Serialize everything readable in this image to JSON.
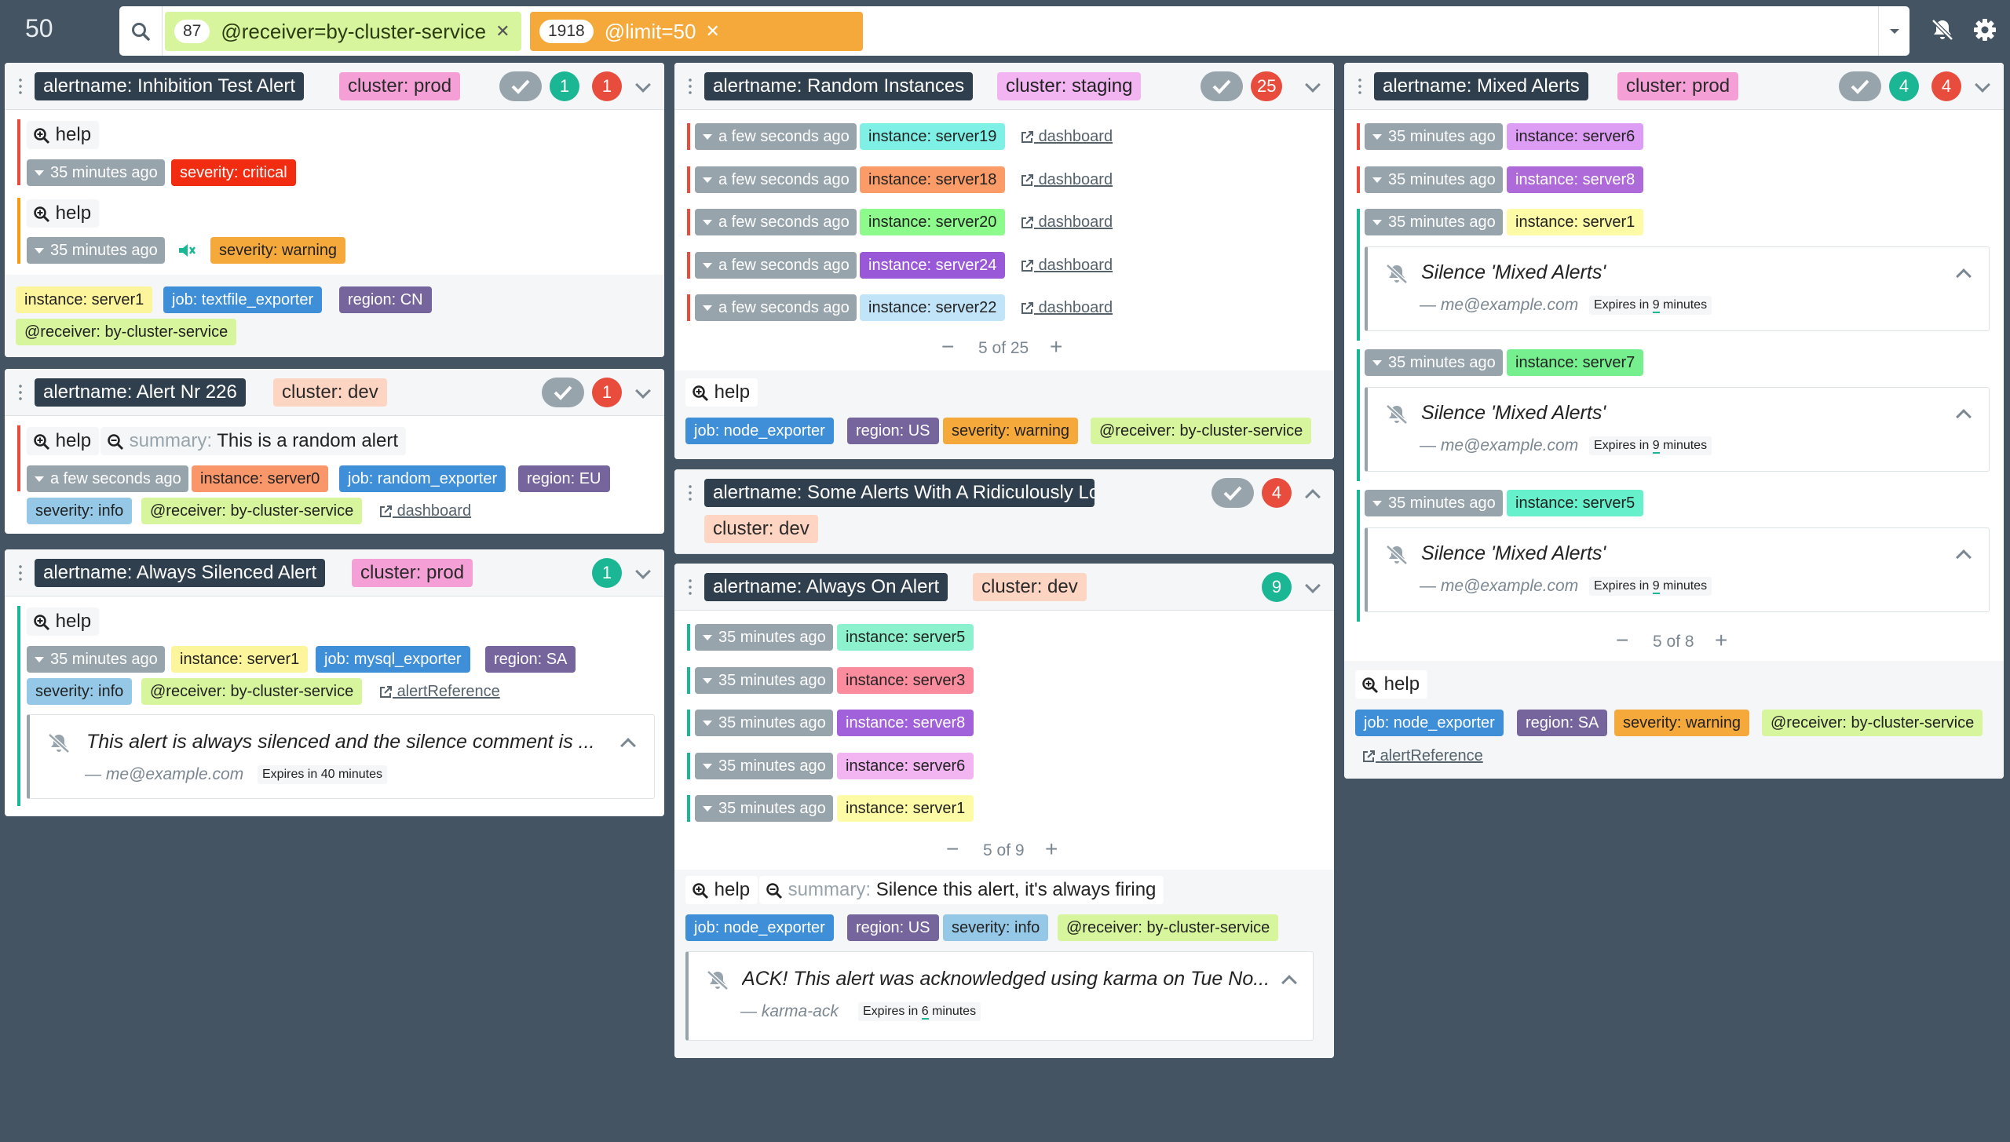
{
  "topbar": {
    "count": "50",
    "filters": [
      {
        "count": "87",
        "text": "@receiver=by-cluster-service"
      },
      {
        "count": "1918",
        "text": "@limit=50"
      }
    ]
  },
  "colors": {
    "background": "#455463",
    "green": "#1bb795",
    "red": "#e74c3c",
    "gray": "#98a4ac"
  },
  "col1": {
    "g1": {
      "alertname": "alertname: Inhibition Test Alert",
      "cluster": "cluster: prod",
      "green_count": "1",
      "red_count": "1",
      "help1": "help",
      "age1": "35 minutes ago",
      "sev1": "severity: critical",
      "help2": "help",
      "age2": "35 minutes ago",
      "sev2": "severity: warning",
      "labels": [
        "instance: server1",
        "job: textfile_exporter",
        "region: CN",
        "@receiver: by-cluster-service"
      ]
    },
    "g2": {
      "alertname": "alertname: Alert Nr 226",
      "cluster": "cluster: dev",
      "red_count": "1",
      "help": "help",
      "summary_key": "summary:",
      "summary_val": "This is a random alert",
      "age": "a few seconds ago",
      "labels": [
        "instance: server0",
        "job: random_exporter",
        "region: EU",
        "severity: info",
        "@receiver: by-cluster-service"
      ],
      "link": "dashboard"
    },
    "g3": {
      "alertname": "alertname: Always Silenced Alert",
      "cluster": "cluster: prod",
      "green_count": "1",
      "help": "help",
      "age": "35 minutes ago",
      "labels": [
        "instance: server1",
        "job: mysql_exporter",
        "region: SA",
        "severity: info",
        "@receiver: by-cluster-service"
      ],
      "link": "alertReference",
      "silence_comment": "This alert is always silenced and the silence comment is ...",
      "silence_author": "— me@example.com",
      "silence_expires": "Expires in 40 minutes"
    }
  },
  "col2": {
    "g1": {
      "alertname": "alertname: Random Instances",
      "cluster": "cluster: staging",
      "red_count": "25",
      "rows": [
        {
          "age": "a few seconds ago",
          "instance": "instance: server19",
          "link": "dashboard"
        },
        {
          "age": "a few seconds ago",
          "instance": "instance: server18",
          "link": "dashboard"
        },
        {
          "age": "a few seconds ago",
          "instance": "instance: server20",
          "link": "dashboard"
        },
        {
          "age": "a few seconds ago",
          "instance": "instance: server24",
          "link": "dashboard"
        },
        {
          "age": "a few seconds ago",
          "instance": "instance: server22",
          "link": "dashboard"
        }
      ],
      "pager": "5 of 25",
      "help": "help",
      "labels": [
        "job: node_exporter",
        "region: US",
        "severity: warning",
        "@receiver: by-cluster-service"
      ]
    },
    "g2": {
      "alertname": "alertname: Some Alerts With A Ridiculously Long Na...",
      "cluster": "cluster: dev",
      "red_count": "4"
    },
    "g3": {
      "alertname": "alertname: Always On Alert",
      "cluster": "cluster: dev",
      "green_count": "9",
      "rows": [
        {
          "age": "35 minutes ago",
          "instance": "instance: server5"
        },
        {
          "age": "35 minutes ago",
          "instance": "instance: server3"
        },
        {
          "age": "35 minutes ago",
          "instance": "instance: server8"
        },
        {
          "age": "35 minutes ago",
          "instance": "instance: server6"
        },
        {
          "age": "35 minutes ago",
          "instance": "instance: server1"
        }
      ],
      "pager": "5 of 9",
      "help": "help",
      "summary_key": "summary:",
      "summary_val": "Silence this alert, it's always firing",
      "labels": [
        "job: node_exporter",
        "region: US",
        "severity: info",
        "@receiver: by-cluster-service"
      ],
      "silence_comment": "ACK! This alert was acknowledged using karma on Tue No...",
      "silence_author": "— karma-ack",
      "silence_expires_pre": "Expires in ",
      "silence_expires_num": "6",
      "silence_expires_post": " minutes"
    }
  },
  "col3": {
    "g1": {
      "alertname": "alertname: Mixed Alerts",
      "cluster": "cluster: prod",
      "green_count": "4",
      "red_count": "4",
      "rows": [
        {
          "age": "35 minutes ago",
          "instance": "instance: server6"
        },
        {
          "age": "35 minutes ago",
          "instance": "instance: server8"
        },
        {
          "age": "35 minutes ago",
          "instance": "instance: server1"
        },
        {
          "age": "35 minutes ago",
          "instance": "instance: server7"
        },
        {
          "age": "35 minutes ago",
          "instance": "instance: server5"
        }
      ],
      "silence_comment": "Silence 'Mixed Alerts'",
      "silence_author": "— me@example.com",
      "silence_expires_pre": "Expires in ",
      "silence_expires_num": "9",
      "silence_expires_post": " minutes",
      "pager": "5 of 8",
      "help": "help",
      "labels": [
        "job: node_exporter",
        "region: SA",
        "severity: warning",
        "@receiver: by-cluster-service"
      ],
      "link": "alertReference"
    }
  }
}
